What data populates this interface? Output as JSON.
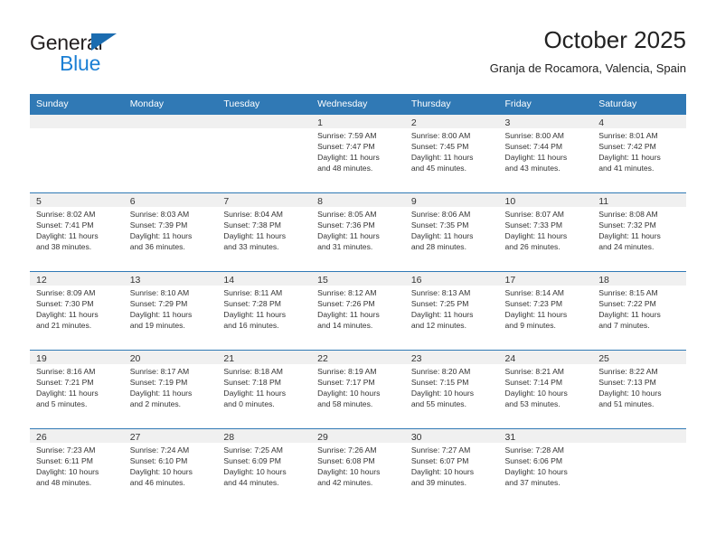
{
  "brand": {
    "name_part1": "General",
    "name_part2": "Blue",
    "triangle_color": "#1b6cb0",
    "blue_color": "#1b7fd4"
  },
  "header": {
    "title": "October 2025",
    "subtitle": "Granja de Rocamora, Valencia, Spain"
  },
  "theme": {
    "header_bg": "#3079b5",
    "daynum_bg": "#f0f0f0",
    "rule_color": "#3079b5",
    "text_color": "#333333"
  },
  "weekday_headers": [
    "Sunday",
    "Monday",
    "Tuesday",
    "Wednesday",
    "Thursday",
    "Friday",
    "Saturday"
  ],
  "labels": {
    "sunrise_prefix": "Sunrise:",
    "sunset_prefix": "Sunset:",
    "daylight_prefix": "Daylight:"
  },
  "weeks": [
    [
      {
        "day": "",
        "line1": "",
        "line2": "",
        "line3": "",
        "line4": ""
      },
      {
        "day": "",
        "line1": "",
        "line2": "",
        "line3": "",
        "line4": ""
      },
      {
        "day": "",
        "line1": "",
        "line2": "",
        "line3": "",
        "line4": ""
      },
      {
        "day": "1",
        "line1": "Sunrise: 7:59 AM",
        "line2": "Sunset: 7:47 PM",
        "line3": "Daylight: 11 hours",
        "line4": "and 48 minutes."
      },
      {
        "day": "2",
        "line1": "Sunrise: 8:00 AM",
        "line2": "Sunset: 7:45 PM",
        "line3": "Daylight: 11 hours",
        "line4": "and 45 minutes."
      },
      {
        "day": "3",
        "line1": "Sunrise: 8:00 AM",
        "line2": "Sunset: 7:44 PM",
        "line3": "Daylight: 11 hours",
        "line4": "and 43 minutes."
      },
      {
        "day": "4",
        "line1": "Sunrise: 8:01 AM",
        "line2": "Sunset: 7:42 PM",
        "line3": "Daylight: 11 hours",
        "line4": "and 41 minutes."
      }
    ],
    [
      {
        "day": "5",
        "line1": "Sunrise: 8:02 AM",
        "line2": "Sunset: 7:41 PM",
        "line3": "Daylight: 11 hours",
        "line4": "and 38 minutes."
      },
      {
        "day": "6",
        "line1": "Sunrise: 8:03 AM",
        "line2": "Sunset: 7:39 PM",
        "line3": "Daylight: 11 hours",
        "line4": "and 36 minutes."
      },
      {
        "day": "7",
        "line1": "Sunrise: 8:04 AM",
        "line2": "Sunset: 7:38 PM",
        "line3": "Daylight: 11 hours",
        "line4": "and 33 minutes."
      },
      {
        "day": "8",
        "line1": "Sunrise: 8:05 AM",
        "line2": "Sunset: 7:36 PM",
        "line3": "Daylight: 11 hours",
        "line4": "and 31 minutes."
      },
      {
        "day": "9",
        "line1": "Sunrise: 8:06 AM",
        "line2": "Sunset: 7:35 PM",
        "line3": "Daylight: 11 hours",
        "line4": "and 28 minutes."
      },
      {
        "day": "10",
        "line1": "Sunrise: 8:07 AM",
        "line2": "Sunset: 7:33 PM",
        "line3": "Daylight: 11 hours",
        "line4": "and 26 minutes."
      },
      {
        "day": "11",
        "line1": "Sunrise: 8:08 AM",
        "line2": "Sunset: 7:32 PM",
        "line3": "Daylight: 11 hours",
        "line4": "and 24 minutes."
      }
    ],
    [
      {
        "day": "12",
        "line1": "Sunrise: 8:09 AM",
        "line2": "Sunset: 7:30 PM",
        "line3": "Daylight: 11 hours",
        "line4": "and 21 minutes."
      },
      {
        "day": "13",
        "line1": "Sunrise: 8:10 AM",
        "line2": "Sunset: 7:29 PM",
        "line3": "Daylight: 11 hours",
        "line4": "and 19 minutes."
      },
      {
        "day": "14",
        "line1": "Sunrise: 8:11 AM",
        "line2": "Sunset: 7:28 PM",
        "line3": "Daylight: 11 hours",
        "line4": "and 16 minutes."
      },
      {
        "day": "15",
        "line1": "Sunrise: 8:12 AM",
        "line2": "Sunset: 7:26 PM",
        "line3": "Daylight: 11 hours",
        "line4": "and 14 minutes."
      },
      {
        "day": "16",
        "line1": "Sunrise: 8:13 AM",
        "line2": "Sunset: 7:25 PM",
        "line3": "Daylight: 11 hours",
        "line4": "and 12 minutes."
      },
      {
        "day": "17",
        "line1": "Sunrise: 8:14 AM",
        "line2": "Sunset: 7:23 PM",
        "line3": "Daylight: 11 hours",
        "line4": "and 9 minutes."
      },
      {
        "day": "18",
        "line1": "Sunrise: 8:15 AM",
        "line2": "Sunset: 7:22 PM",
        "line3": "Daylight: 11 hours",
        "line4": "and 7 minutes."
      }
    ],
    [
      {
        "day": "19",
        "line1": "Sunrise: 8:16 AM",
        "line2": "Sunset: 7:21 PM",
        "line3": "Daylight: 11 hours",
        "line4": "and 5 minutes."
      },
      {
        "day": "20",
        "line1": "Sunrise: 8:17 AM",
        "line2": "Sunset: 7:19 PM",
        "line3": "Daylight: 11 hours",
        "line4": "and 2 minutes."
      },
      {
        "day": "21",
        "line1": "Sunrise: 8:18 AM",
        "line2": "Sunset: 7:18 PM",
        "line3": "Daylight: 11 hours",
        "line4": "and 0 minutes."
      },
      {
        "day": "22",
        "line1": "Sunrise: 8:19 AM",
        "line2": "Sunset: 7:17 PM",
        "line3": "Daylight: 10 hours",
        "line4": "and 58 minutes."
      },
      {
        "day": "23",
        "line1": "Sunrise: 8:20 AM",
        "line2": "Sunset: 7:15 PM",
        "line3": "Daylight: 10 hours",
        "line4": "and 55 minutes."
      },
      {
        "day": "24",
        "line1": "Sunrise: 8:21 AM",
        "line2": "Sunset: 7:14 PM",
        "line3": "Daylight: 10 hours",
        "line4": "and 53 minutes."
      },
      {
        "day": "25",
        "line1": "Sunrise: 8:22 AM",
        "line2": "Sunset: 7:13 PM",
        "line3": "Daylight: 10 hours",
        "line4": "and 51 minutes."
      }
    ],
    [
      {
        "day": "26",
        "line1": "Sunrise: 7:23 AM",
        "line2": "Sunset: 6:11 PM",
        "line3": "Daylight: 10 hours",
        "line4": "and 48 minutes."
      },
      {
        "day": "27",
        "line1": "Sunrise: 7:24 AM",
        "line2": "Sunset: 6:10 PM",
        "line3": "Daylight: 10 hours",
        "line4": "and 46 minutes."
      },
      {
        "day": "28",
        "line1": "Sunrise: 7:25 AM",
        "line2": "Sunset: 6:09 PM",
        "line3": "Daylight: 10 hours",
        "line4": "and 44 minutes."
      },
      {
        "day": "29",
        "line1": "Sunrise: 7:26 AM",
        "line2": "Sunset: 6:08 PM",
        "line3": "Daylight: 10 hours",
        "line4": "and 42 minutes."
      },
      {
        "day": "30",
        "line1": "Sunrise: 7:27 AM",
        "line2": "Sunset: 6:07 PM",
        "line3": "Daylight: 10 hours",
        "line4": "and 39 minutes."
      },
      {
        "day": "31",
        "line1": "Sunrise: 7:28 AM",
        "line2": "Sunset: 6:06 PM",
        "line3": "Daylight: 10 hours",
        "line4": "and 37 minutes."
      },
      {
        "day": "",
        "line1": "",
        "line2": "",
        "line3": "",
        "line4": ""
      }
    ]
  ]
}
